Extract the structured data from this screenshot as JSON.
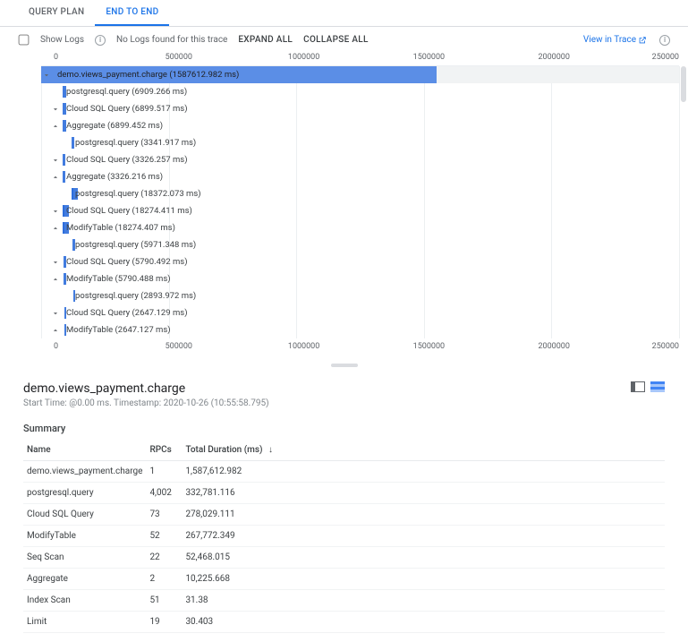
{
  "tabs": {
    "query_plan": "QUERY PLAN",
    "end_to_end": "END TO END"
  },
  "toolbar": {
    "show_logs": "Show Logs",
    "no_logs": "No Logs found for this trace",
    "expand_all": "EXPAND ALL",
    "collapse_all": "COLLAPSE ALL",
    "view_in_trace": "View in Trace"
  },
  "axis": {
    "t0": "0",
    "t1": "500000",
    "t2": "1000000",
    "t3": "1500000",
    "t4": "2000000",
    "t5": "250000"
  },
  "rows": [
    {
      "indent": 0,
      "toggle": "down",
      "selected": true,
      "name": "demo.views_payment.charge",
      "dur": "1587612.982 ms",
      "barW": 62
    },
    {
      "indent": 1,
      "toggle": "",
      "name": "postgresql.query",
      "dur": "6909.266 ms",
      "barW": 0.5,
      "barL": 0.2
    },
    {
      "indent": 1,
      "toggle": "down",
      "name": "Cloud SQL Query",
      "dur": "6899.517 ms",
      "barW": 0.5,
      "barL": 0.2
    },
    {
      "indent": 1,
      "toggle": "up",
      "name": "Aggregate",
      "dur": "6899.452 ms",
      "barW": 0.5,
      "barL": 0.2
    },
    {
      "indent": 2,
      "toggle": "",
      "name": "postgresql.query",
      "dur": "3341.917 ms",
      "barW": 0.3,
      "barL": 0.4
    },
    {
      "indent": 1,
      "toggle": "down",
      "name": "Cloud SQL Query",
      "dur": "3326.257 ms",
      "barW": 0.3,
      "barL": 0.4
    },
    {
      "indent": 1,
      "toggle": "up",
      "name": "Aggregate",
      "dur": "3326.216 ms",
      "barW": 0.3,
      "barL": 0.4
    },
    {
      "indent": 2,
      "toggle": "",
      "tick": true,
      "name": "postgresql.query",
      "dur": "18372.073 ms",
      "barW": 0.9,
      "barL": 0.6
    },
    {
      "indent": 1,
      "toggle": "down",
      "tick": true,
      "name": "Cloud SQL Query",
      "dur": "18274.411 ms",
      "barW": 0.9,
      "barL": 0.6
    },
    {
      "indent": 1,
      "toggle": "up",
      "tick": true,
      "name": "ModifyTable",
      "dur": "18274.407 ms",
      "barW": 0.9,
      "barL": 0.6
    },
    {
      "indent": 2,
      "toggle": "",
      "name": "postgresql.query",
      "dur": "5971.348 ms",
      "barW": 0.4,
      "barL": 1.2
    },
    {
      "indent": 1,
      "toggle": "down",
      "name": "Cloud SQL Query",
      "dur": "5790.492 ms",
      "barW": 0.4,
      "barL": 1.2
    },
    {
      "indent": 1,
      "toggle": "up",
      "name": "ModifyTable",
      "dur": "5790.488 ms",
      "barW": 0.4,
      "barL": 1.2
    },
    {
      "indent": 2,
      "toggle": "",
      "name": "postgresql.query",
      "dur": "2893.972 ms",
      "barW": 0.3,
      "barL": 1.5
    },
    {
      "indent": 1,
      "toggle": "down",
      "name": "Cloud SQL Query",
      "dur": "2647.129 ms",
      "barW": 0.3,
      "barL": 1.5
    },
    {
      "indent": 1,
      "toggle": "up",
      "name": "ModifyTable",
      "dur": "2647.127 ms",
      "barW": 0.3,
      "barL": 1.5
    }
  ],
  "details": {
    "title": "demo.views_payment.charge",
    "subtitle": "Start Time: @0.00 ms. Timestamp: 2020-10-26 (10:55:58.795)",
    "summary_heading": "Summary",
    "columns": {
      "name": "Name",
      "rpcs": "RPCs",
      "total": "Total Duration (ms)"
    },
    "rows": [
      {
        "name": "demo.views_payment.charge",
        "rpcs": "1",
        "total": "1,587,612.982"
      },
      {
        "name": "postgresql.query",
        "rpcs": "4,002",
        "total": "332,781.116"
      },
      {
        "name": "Cloud SQL Query",
        "rpcs": "73",
        "total": "278,029.111"
      },
      {
        "name": "ModifyTable",
        "rpcs": "52",
        "total": "267,772.349"
      },
      {
        "name": "Seq Scan",
        "rpcs": "22",
        "total": "52,468.015"
      },
      {
        "name": "Aggregate",
        "rpcs": "2",
        "total": "10,225.668"
      },
      {
        "name": "Index Scan",
        "rpcs": "51",
        "total": "31.38"
      },
      {
        "name": "Limit",
        "rpcs": "19",
        "total": "30.403"
      }
    ]
  },
  "chart_data": {
    "type": "table",
    "title": "Span Summary",
    "columns": [
      "Name",
      "RPCs",
      "Total Duration (ms)"
    ],
    "rows": [
      [
        "demo.views_payment.charge",
        1,
        1587612.982
      ],
      [
        "postgresql.query",
        4002,
        332781.116
      ],
      [
        "Cloud SQL Query",
        73,
        278029.111
      ],
      [
        "ModifyTable",
        52,
        267772.349
      ],
      [
        "Seq Scan",
        22,
        52468.015
      ],
      [
        "Aggregate",
        2,
        10225.668
      ],
      [
        "Index Scan",
        51,
        31.38
      ],
      [
        "Limit",
        19,
        30.403
      ]
    ]
  }
}
